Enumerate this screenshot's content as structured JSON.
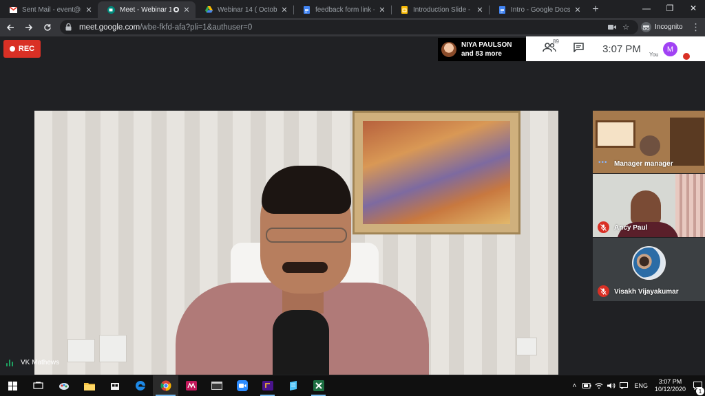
{
  "browser": {
    "tabs": [
      {
        "title": "Sent Mail - event@mca",
        "favicon": "gmail-icon",
        "active": false
      },
      {
        "title": "Meet - Webinar 14(",
        "favicon": "meet-icon",
        "active": true,
        "recording": true
      },
      {
        "title": "Webinar 14 ( October 1",
        "favicon": "drive-icon",
        "active": false
      },
      {
        "title": "feedback form link - Go",
        "favicon": "docs-icon",
        "active": false
      },
      {
        "title": "Introduction Slide - Goo",
        "favicon": "slides-icon",
        "active": false
      },
      {
        "title": "Intro - Google Docs",
        "favicon": "docs-icon",
        "active": false
      }
    ],
    "address": {
      "host": "meet.google.com",
      "path": "/wbe-fkfd-afa?pli=1&authuser=0"
    },
    "incognito_label": "Incognito"
  },
  "meet": {
    "rec_label": "REC",
    "presence": {
      "name": "NIYA PAULSON",
      "more": "and 83 more"
    },
    "participant_count": "89",
    "time": "3:07  PM",
    "self": {
      "label": "You",
      "initial": "M"
    },
    "speaker_name": "VK Mathews",
    "tiles": [
      {
        "name": "Manager manager",
        "muted": false
      },
      {
        "name": "Ancy Paul",
        "muted": true
      },
      {
        "name": "Visakh Vijayakumar",
        "muted": true
      }
    ]
  },
  "taskbar": {
    "apps": [
      "windows-start",
      "task-view",
      "paint-app",
      "file-explorer",
      "store-app",
      "edge-browser",
      "chrome-browser",
      "mendeley-app",
      "window-app",
      "zoom-app",
      "app-purple",
      "app-notes",
      "excel-app"
    ],
    "tray": {
      "language": "ENG",
      "time": "3:07 PM",
      "date": "10/12/2020",
      "notification_count": "1"
    }
  },
  "colors": {
    "meet_bg": "#202124",
    "rec_red": "#d93025",
    "self_avatar": "#a142f4",
    "speaking_green": "#1ea362"
  }
}
